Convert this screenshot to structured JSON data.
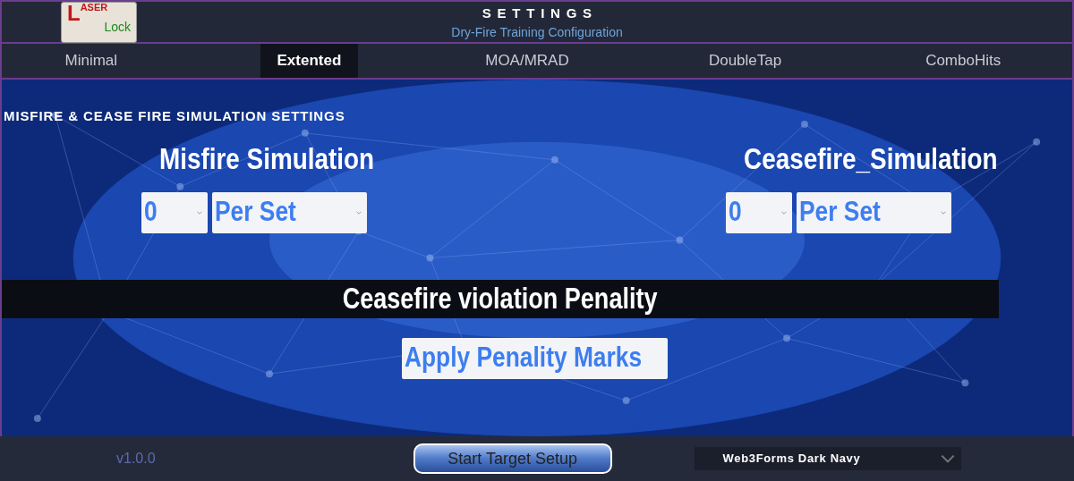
{
  "header": {
    "logo": {
      "line1": "ASER",
      "initial": "L",
      "line2": "Lock"
    },
    "title": "SETTINGS",
    "subtitle": "Dry-Fire Training Configuration"
  },
  "tabs": [
    {
      "label": "Minimal",
      "selected": false
    },
    {
      "label": "Extented",
      "selected": true
    },
    {
      "label": "MOA/MRAD",
      "selected": false
    },
    {
      "label": "DoubleTap",
      "selected": false
    },
    {
      "label": "ComboHits",
      "selected": false
    }
  ],
  "section_title": "MISFIRE & CEASE FIRE SIMULATION SETTINGS",
  "groups": [
    {
      "title": "Misfire Simulation",
      "count": "0",
      "unit": "Per Set"
    },
    {
      "title": "Ceasefire_Simulation",
      "count": "0",
      "unit": "Per Set"
    }
  ],
  "penalty": {
    "title": "Ceasefire violation Penality",
    "value": "Apply Penality Marks"
  },
  "footer": {
    "version": "v1.0.0",
    "button": "Start Target Setup",
    "theme": "Web3Forms Dark Navy"
  }
}
